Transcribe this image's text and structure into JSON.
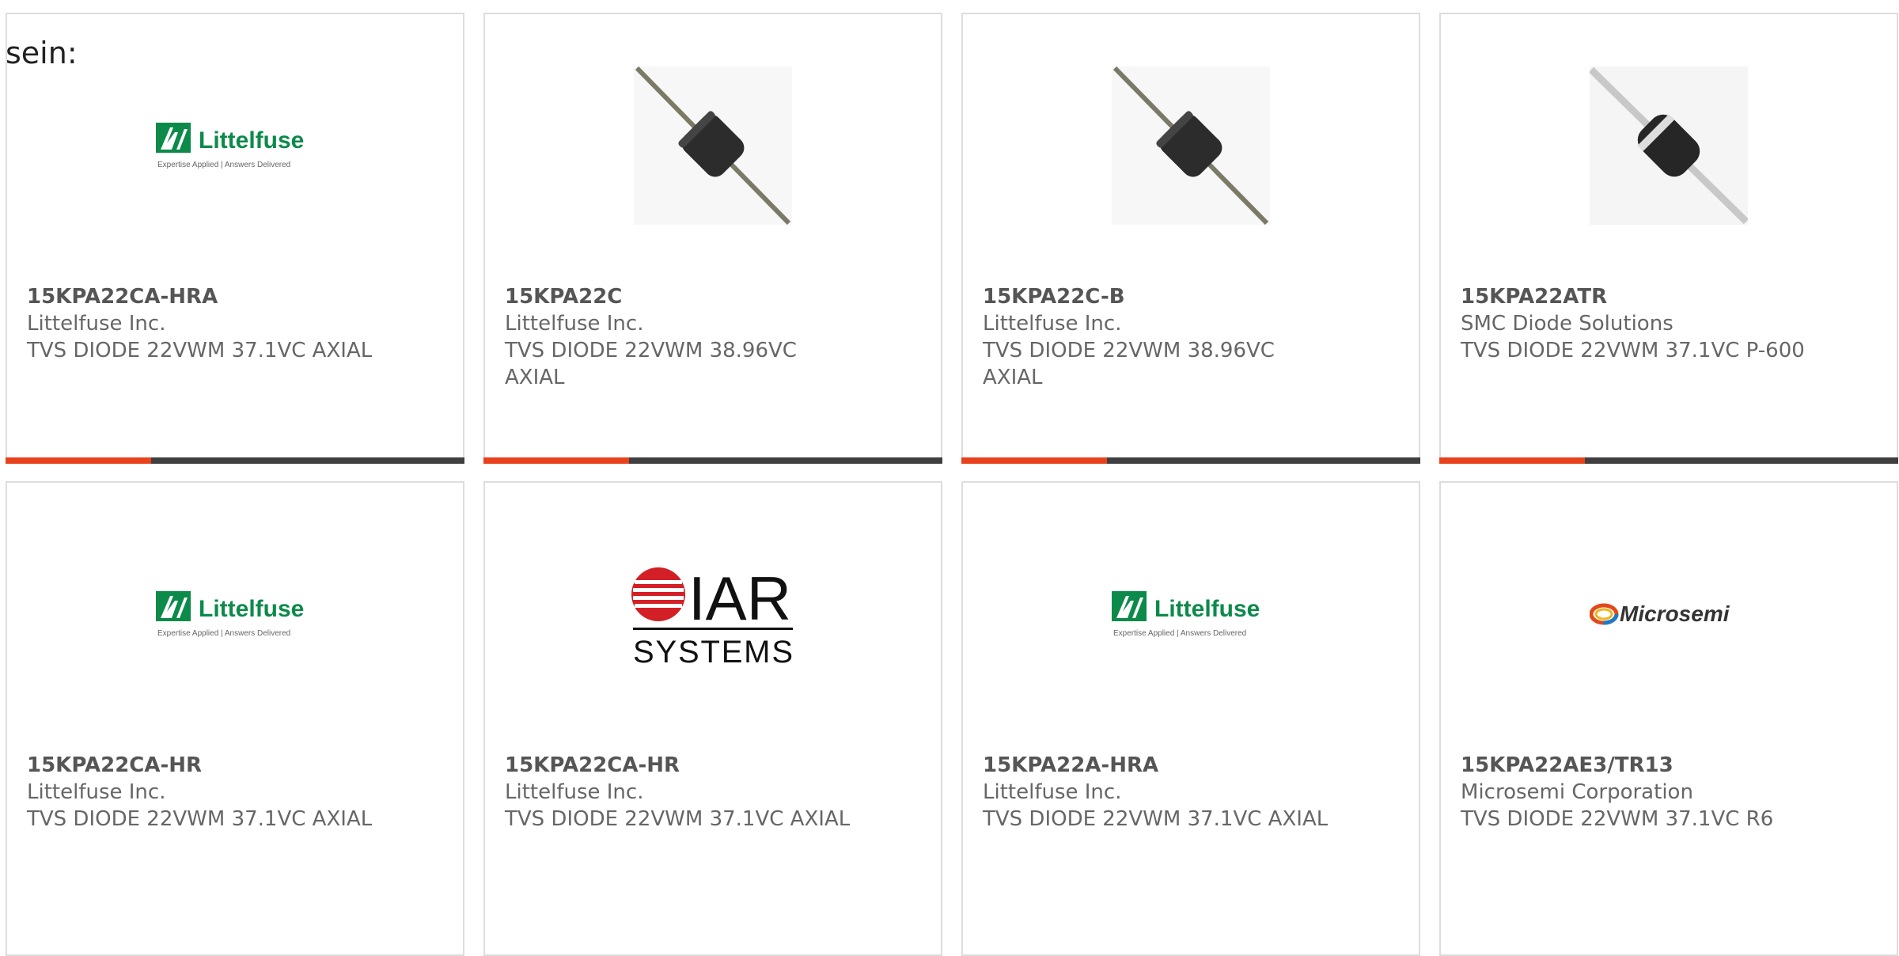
{
  "intro_text": "sein:",
  "colors": {
    "accent": "#e8421c",
    "bar": "#3f3f3f",
    "border": "#dddddd",
    "text": "#666666"
  },
  "cards": [
    {
      "mpn": "15KPA22CA-HRA",
      "manufacturer": "Littelfuse Inc.",
      "description": "TVS DIODE 22VWM 37.1VC AXIAL",
      "image": "littelfuse-logo"
    },
    {
      "mpn": "15KPA22C",
      "manufacturer": "Littelfuse Inc.",
      "description": "TVS DIODE 22VWM 38.96VC AXIAL",
      "image": "axial-diode-photo"
    },
    {
      "mpn": "15KPA22C-B",
      "manufacturer": "Littelfuse Inc.",
      "description": "TVS DIODE 22VWM 38.96VC AXIAL",
      "image": "axial-diode-photo"
    },
    {
      "mpn": "15KPA22ATR",
      "manufacturer": "SMC Diode Solutions",
      "description": "TVS DIODE 22VWM 37.1VC P-600",
      "image": "axial-diode-silver-photo"
    },
    {
      "mpn": "15KPA22CA-HR",
      "manufacturer": "Littelfuse Inc.",
      "description": "TVS DIODE 22VWM 37.1VC AXIAL",
      "image": "littelfuse-logo"
    },
    {
      "mpn": "15KPA22CA-HR",
      "manufacturer": "Littelfuse Inc.",
      "description": "TVS DIODE 22VWM 37.1VC AXIAL",
      "image": "iar-systems-logo"
    },
    {
      "mpn": "15KPA22A-HRA",
      "manufacturer": "Littelfuse Inc.",
      "description": "TVS DIODE 22VWM 37.1VC AXIAL",
      "image": "littelfuse-logo"
    },
    {
      "mpn": "15KPA22AE3/TR13",
      "manufacturer": "Microsemi Corporation",
      "description": "TVS DIODE 22VWM 37.1VC R6",
      "image": "microsemi-logo"
    }
  ],
  "logos": {
    "littelfuse": {
      "name": "Littelfuse",
      "tagline": "Expertise Applied | Answers Delivered"
    },
    "iar": {
      "top": "IAR",
      "bottom": "SYSTEMS"
    },
    "microsemi": {
      "name": "Microsemi"
    }
  }
}
